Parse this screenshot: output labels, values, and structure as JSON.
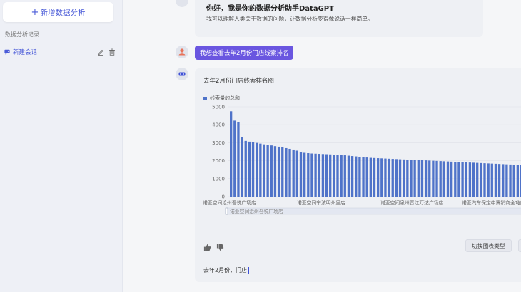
{
  "sidebar": {
    "new_chat_label": "新增数据分析",
    "section_title": "数据分析记录",
    "conversations": [
      {
        "label": "新建会话"
      }
    ]
  },
  "chat": {
    "greeting_title": "你好，我是你的数据分析助手DataGPT",
    "greeting_subtitle": "我可以理解人类关于数据的问题，让数据分析变得像说话一样简单。",
    "user_message": "我想查看去年2月份门店线索排名",
    "switch_chart_label": "切换图表类型",
    "input_text": "去年2月份，门店"
  },
  "colors": {
    "accent": "#4a5bd8",
    "user_bubble": "#6a56e0",
    "bar": "#4f73c9"
  },
  "icons": [
    "plus-icon",
    "chat-icon",
    "edit-icon",
    "trash-icon",
    "user-avatar-icon",
    "bot-avatar-icon",
    "thumb-up-icon",
    "thumb-down-icon"
  ],
  "chart_data": {
    "type": "bar",
    "title": "去年2月份门店线索排名图",
    "legend": [
      "线索量的总和"
    ],
    "ylim": [
      0,
      5000
    ],
    "y_ticks": [
      "0",
      "1000",
      "2000",
      "3000",
      "4000",
      "5000"
    ],
    "x_tick_labels": [
      "诺亚空间沧州吾悦广场店",
      "诺亚空间宁波明州里店",
      "诺亚空间泉州晋江万达广场店",
      "诺亚汽车保定中冀销商全功",
      "诺亚汽车"
    ],
    "slider_label": "诺亚空间沧州吾悦广场店",
    "series": [
      {
        "name": "线索量的总和",
        "values": [
          4750,
          4230,
          4150,
          3320,
          3100,
          3060,
          3020,
          2990,
          2950,
          2910,
          2880,
          2850,
          2810,
          2780,
          2740,
          2700,
          2660,
          2620,
          2560,
          2460,
          2440,
          2420,
          2400,
          2390,
          2380,
          2370,
          2360,
          2350,
          2340,
          2330,
          2320,
          2300,
          2280,
          2260,
          2240,
          2220,
          2200,
          2180,
          2160,
          2150,
          2140,
          2130,
          2120,
          2110,
          2100,
          2090,
          2080,
          2070,
          2060,
          2050,
          2040,
          2040,
          2030,
          2020,
          2010,
          2000,
          1990,
          1980,
          1970,
          1960,
          1950,
          1940,
          1930,
          1920,
          1910,
          1900,
          1890,
          1880,
          1870,
          1860,
          1850,
          1840,
          1830,
          1820,
          1810,
          1800,
          1790,
          1780,
          1770,
          1760,
          1750,
          1740,
          1730,
          1720,
          1710,
          1700,
          1690,
          1680,
          1670,
          1660,
          1650,
          1640,
          1630,
          1620,
          1610,
          1600
        ]
      }
    ]
  }
}
